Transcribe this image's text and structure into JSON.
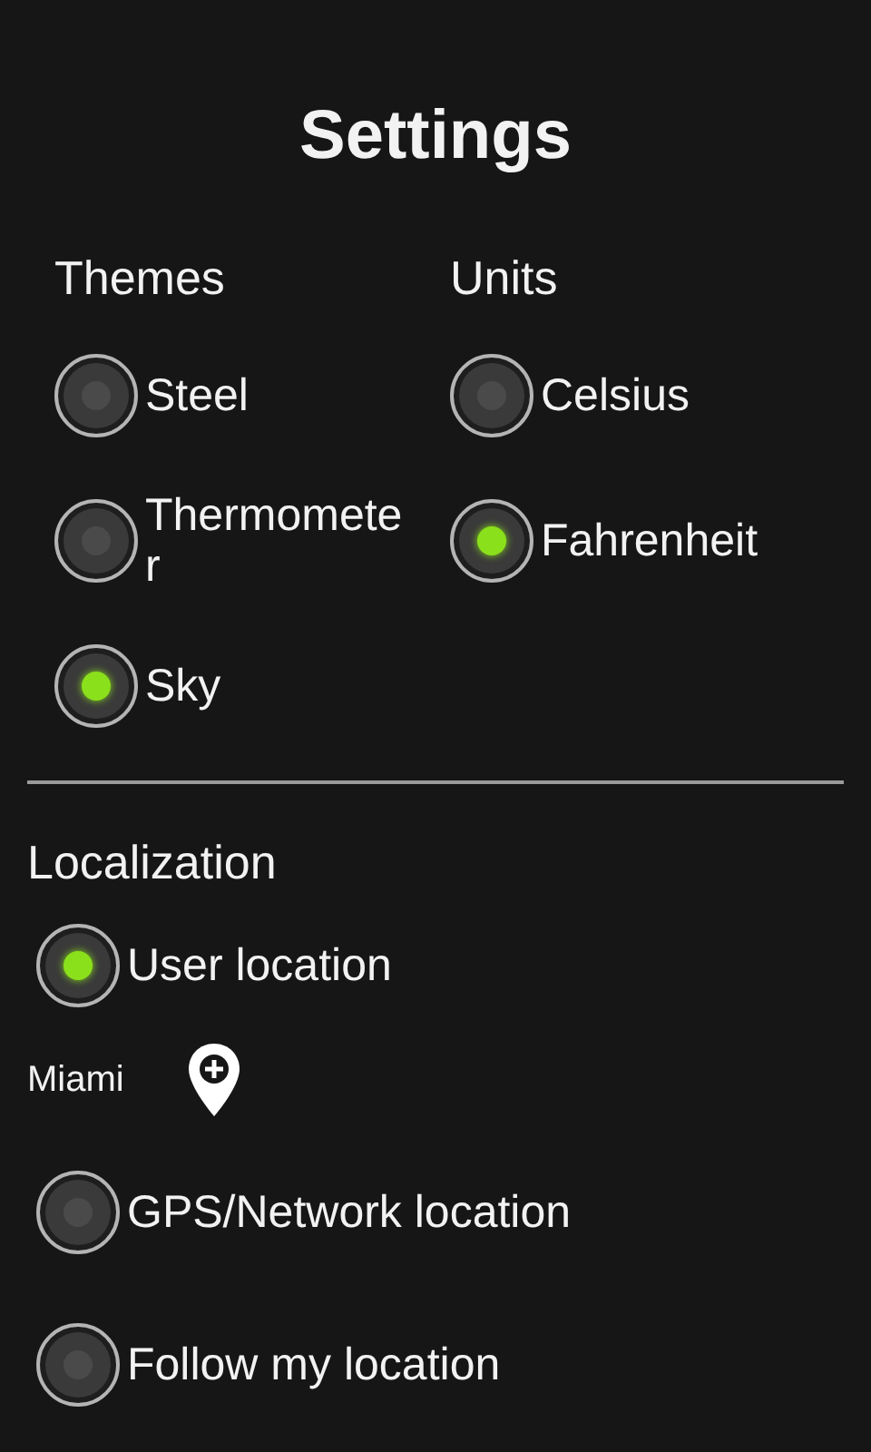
{
  "title": "Settings",
  "themes": {
    "heading": "Themes",
    "options": [
      {
        "label": "Steel",
        "selected": false
      },
      {
        "label": "Thermometer",
        "selected": false
      },
      {
        "label": "Sky",
        "selected": true
      }
    ]
  },
  "units": {
    "heading": "Units",
    "options": [
      {
        "label": "Celsius",
        "selected": false
      },
      {
        "label": "Fahrenheit",
        "selected": true
      }
    ]
  },
  "localization": {
    "heading": "Localization",
    "items": [
      {
        "kind": "radio",
        "label": "User location",
        "selected": true
      },
      {
        "kind": "city",
        "label": "Miami"
      },
      {
        "kind": "radio",
        "label": "GPS/Network location",
        "selected": false
      },
      {
        "kind": "radio",
        "label": "Follow my location",
        "selected": false
      }
    ]
  }
}
